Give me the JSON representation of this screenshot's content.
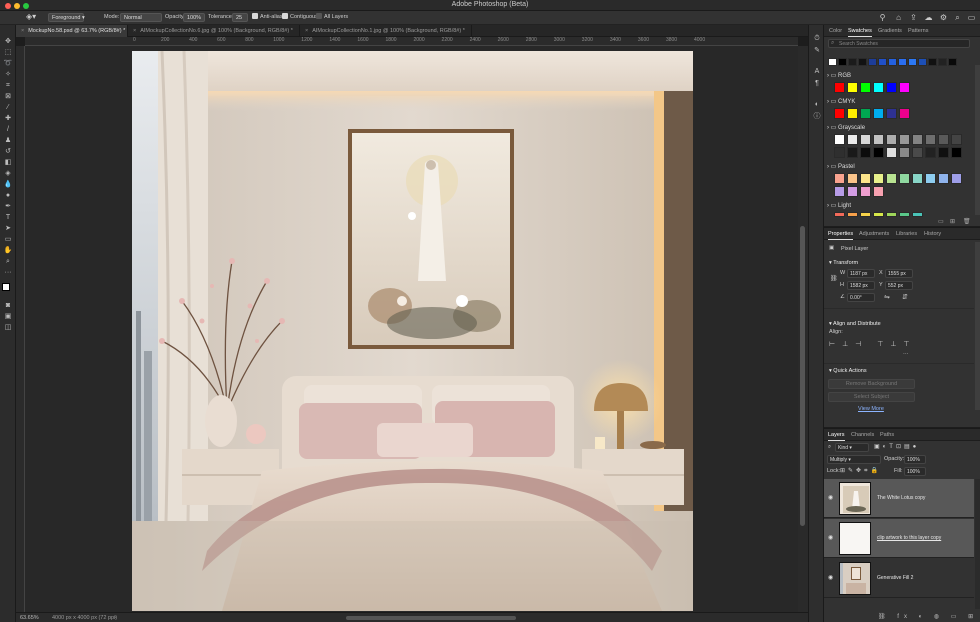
{
  "app": {
    "title": "Adobe Photoshop (Beta)",
    "traffic": [
      "#ff5f57",
      "#febc2e",
      "#28c840"
    ]
  },
  "options": {
    "fill_source": "Foreground",
    "mode_label": "Mode:",
    "mode_value": "Normal",
    "opacity_label": "Opacity:",
    "opacity_value": "100%",
    "tolerance_label": "Tolerance:",
    "tolerance_value": "25",
    "anti_alias": "Anti-alias",
    "contiguous": "Contiguous",
    "all_layers": "All Layers"
  },
  "top_right_icons": [
    "person-icon",
    "home-icon",
    "share-icon",
    "cloud-icon",
    "gear-icon",
    "search-icon",
    "panels-icon"
  ],
  "doc_tabs": [
    {
      "label": "MockupNo.58.psd @ 63.7% (RGB/8#) *",
      "active": true
    },
    {
      "label": "AIMockupCollectionNo.6.jpg @ 100% (Background, RGB/8#) *",
      "active": false
    },
    {
      "label": "AIMockupCollectionNo.1.jpg @ 100% (Background, RGB/8#) *",
      "active": false
    }
  ],
  "ruler": {
    "h_ticks": [
      "0",
      "100",
      "200",
      "300",
      "400",
      "500",
      "600",
      "700",
      "800",
      "900",
      "1000",
      "1100",
      "1200",
      "1300",
      "1400",
      "1500",
      "1600",
      "1700",
      "1800",
      "1900",
      "2000",
      "2100",
      "2200",
      "2300",
      "2400",
      "2500",
      "2600",
      "2700",
      "2800",
      "2900",
      "3000",
      "3100",
      "3200",
      "3300",
      "3400",
      "3500",
      "3600",
      "3700",
      "3800",
      "3900",
      "4000"
    ]
  },
  "status": {
    "zoom": "63.65%",
    "doc_info": "4000 px x 4000 px (72 ppi)"
  },
  "swatches_panel": {
    "tabs": [
      "Color",
      "Swatches",
      "Gradients",
      "Patterns"
    ],
    "active_tab": "Swatches",
    "search_placeholder": "Search Swatches",
    "recent": [
      "#ffffff",
      "#000000",
      "#1b1b1b",
      "#121212",
      "#1d3d99",
      "#2050c8",
      "#2461e0",
      "#2a6ef0",
      "#2c78f4",
      "#1d4fb5",
      "#111111",
      "#222222",
      "#090909"
    ],
    "groups": [
      {
        "name": "RGB",
        "colors": [
          "#ff0000",
          "#ffff00",
          "#00ff00",
          "#00ffff",
          "#0000ff",
          "#ff00ff"
        ]
      },
      {
        "name": "CMYK",
        "colors": [
          "#ff0000",
          "#ffee00",
          "#00a651",
          "#00aeef",
          "#2e3192",
          "#ec008c"
        ]
      },
      {
        "name": "Grayscale",
        "colors": [
          "#ffffff",
          "#ececec",
          "#d7d7d7",
          "#c2c2c2",
          "#adadad",
          "#989898",
          "#838383",
          "#6e6e6e",
          "#595959",
          "#444444",
          "#2f2f2f",
          "#1a1a1a",
          "#0c0c0c",
          "#000000",
          "#e0e0e0",
          "#8a8a8a",
          "#4a4a4a",
          "#222222",
          "#101010",
          "#000000"
        ]
      },
      {
        "name": "Pastel",
        "colors": [
          "#f9a38f",
          "#fbc48a",
          "#fde58b",
          "#e8f08b",
          "#b8e391",
          "#8fd8a0",
          "#88d5c7",
          "#8ecdf0",
          "#8fb3ec",
          "#9e9ee8",
          "#b69be6",
          "#d39de4",
          "#f09fd0",
          "#f7a1b0"
        ]
      },
      {
        "name": "Light",
        "colors": [
          "#f36a5a",
          "#f7a04a",
          "#f7d34a",
          "#d7e84a",
          "#9ed65a",
          "#5ac88a",
          "#4ac4b8"
        ]
      }
    ]
  },
  "properties_panel": {
    "tabs": [
      "Properties",
      "Adjustments",
      "Libraries",
      "History"
    ],
    "active_tab": "Properties",
    "layer_type": "Pixel Layer",
    "transform_title": "Transform",
    "w_label": "W",
    "w_value": "1187 px",
    "x_label": "X",
    "x_value": "1555 px",
    "h_label": "H",
    "h_value": "1582 px",
    "y_label": "Y",
    "y_value": "552 px",
    "angle_value": "0.00°",
    "align_title": "Align and Distribute",
    "align_label": "Align:",
    "quick_actions_title": "Quick Actions",
    "remove_bg": "Remove Background",
    "select_subject": "Select Subject",
    "view_more": "View More"
  },
  "layers_panel": {
    "tabs": [
      "Layers",
      "Channels",
      "Paths"
    ],
    "active_tab": "Layers",
    "kind_label": "Kind",
    "blend_mode": "Multiply",
    "opacity_label": "Opacity:",
    "opacity_value": "100%",
    "lock_label": "Lock:",
    "fill_label": "Fill:",
    "fill_value": "100%",
    "layers": [
      {
        "name": "The White Lotus copy",
        "selected": true,
        "thumb": "art"
      },
      {
        "name": "clip artwork to this layer copy",
        "selected": true,
        "thumb": "white"
      },
      {
        "name": "Generative Fill 2",
        "selected": false,
        "thumb": "room"
      }
    ]
  }
}
